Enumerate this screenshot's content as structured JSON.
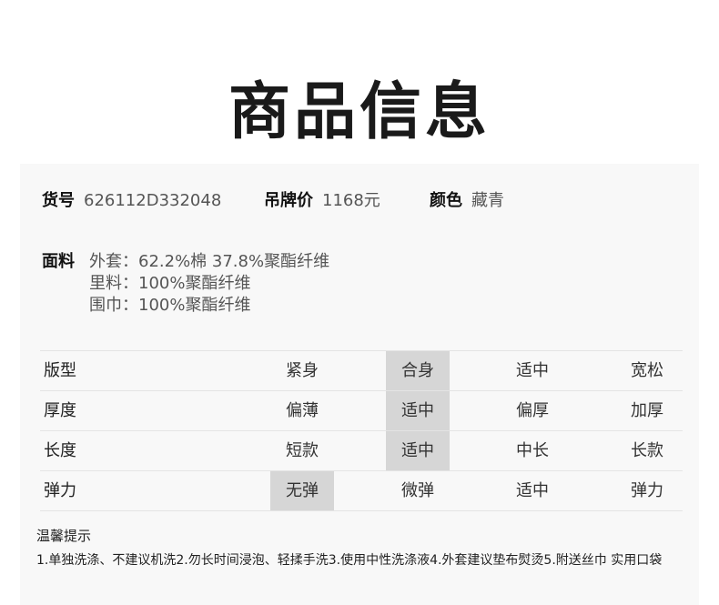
{
  "title": "商品信息",
  "info": {
    "sku_label": "货号",
    "sku_value": "626112D332048",
    "price_label": "吊牌价",
    "price_value": "1168元",
    "color_label": "颜色",
    "color_value": "藏青"
  },
  "fabric": {
    "label": "面料",
    "lines": [
      "外套：62.2%棉 37.8%聚酯纤维",
      "里料：100%聚酯纤维",
      "围巾：100%聚酯纤维"
    ]
  },
  "grid": [
    {
      "label": "版型",
      "options": [
        "紧身",
        "合身",
        "适中",
        "宽松"
      ],
      "selected": 1
    },
    {
      "label": "厚度",
      "options": [
        "偏薄",
        "适中",
        "偏厚",
        "加厚"
      ],
      "selected": 1
    },
    {
      "label": "长度",
      "options": [
        "短款",
        "适中",
        "中长",
        "长款"
      ],
      "selected": 1
    },
    {
      "label": "弹力",
      "options": [
        "无弹",
        "微弹",
        "适中",
        "弹力"
      ],
      "selected": 0
    }
  ],
  "tips": {
    "title": "温馨提示",
    "text": "1.单独洗涤、不建议机洗2.勿长时间浸泡、轻揉手洗3.使用中性洗涤液4.外套建议垫布熨烫5.附送丝巾 实用口袋"
  },
  "colors": {
    "selected_bg": "#d6d6d6",
    "panel_bg": "#f8f8f8"
  }
}
